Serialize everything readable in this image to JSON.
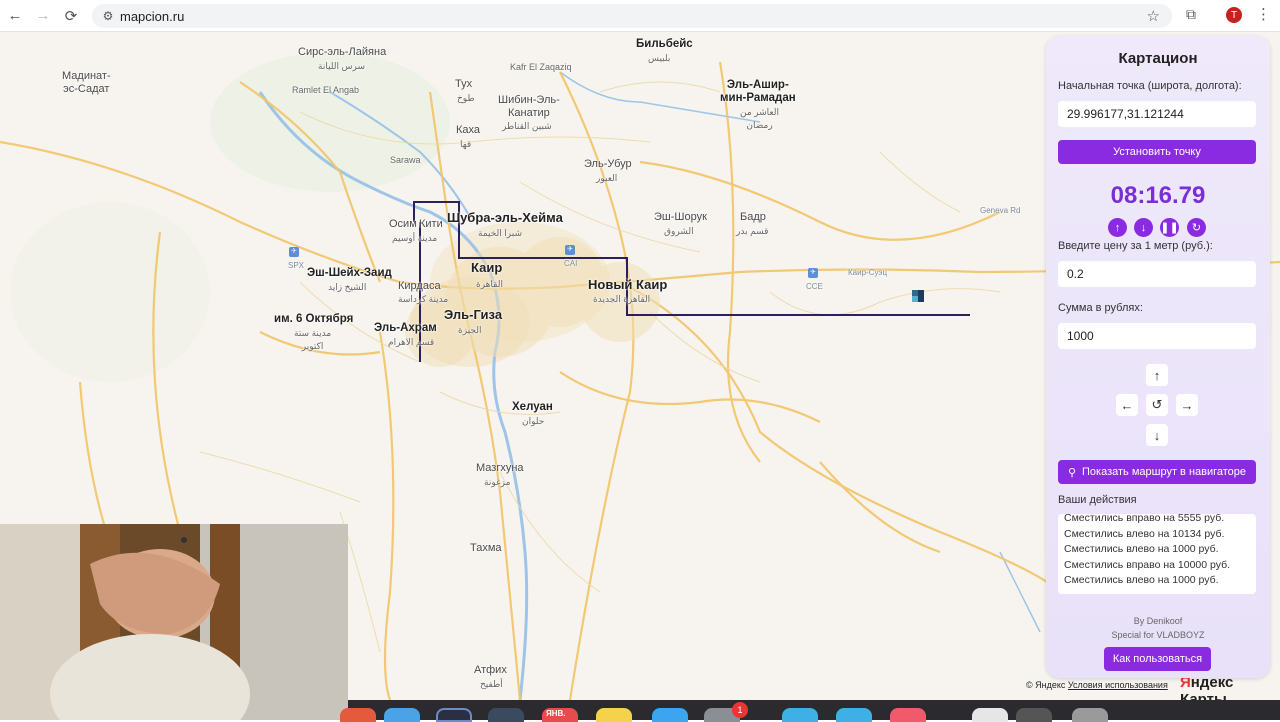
{
  "browser": {
    "url": "mapcion.ru",
    "avatar_letter": "T"
  },
  "map": {
    "labels": [
      {
        "id": "madinat",
        "text": "Мадинат-\nэс-Садат",
        "cls": ""
      },
      {
        "id": "sirs",
        "text": "Сирс-эль-Лайяна",
        "cls": ""
      },
      {
        "id": "sirs_ar",
        "text": "سرس الليانة",
        "cls": "s"
      },
      {
        "id": "ramlet",
        "text": "Ramlet El Angab",
        "cls": "s"
      },
      {
        "id": "bilbeis",
        "text": "Бильбейс",
        "cls": "b"
      },
      {
        "id": "bilbeis_ar",
        "text": "بلبيس",
        "cls": "s"
      },
      {
        "id": "kafr",
        "text": "Kafr El Zaqaziq",
        "cls": "s"
      },
      {
        "id": "tukh",
        "text": "Тух",
        "cls": ""
      },
      {
        "id": "tukh_ar",
        "text": "طوخ",
        "cls": "s"
      },
      {
        "id": "shibin",
        "text": "Шибин-Эль-\nКанатир",
        "cls": ""
      },
      {
        "id": "shibin_ar",
        "text": "شبين القناطر",
        "cls": "s"
      },
      {
        "id": "ashir",
        "text": "Эль-Ашир-\nмин-Рамадан",
        "cls": "b"
      },
      {
        "id": "ashir_ar",
        "text": "العاشر من\nرمضان",
        "cls": "s"
      },
      {
        "id": "kaha",
        "text": "Каха",
        "cls": ""
      },
      {
        "id": "kaha_ar",
        "text": "قها",
        "cls": "s"
      },
      {
        "id": "sarawa",
        "text": "Sarawa",
        "cls": "s"
      },
      {
        "id": "ubur",
        "text": "Эль-Убур",
        "cls": ""
      },
      {
        "id": "ubur_ar",
        "text": "العبور",
        "cls": "s"
      },
      {
        "id": "shubra",
        "text": "Шубра-эль-Хейма",
        "cls": "big"
      },
      {
        "id": "shubra_ar",
        "text": "شبرا الخيمة",
        "cls": "s"
      },
      {
        "id": "osim",
        "text": "Осим",
        "cls": ""
      },
      {
        "id": "osim_ar",
        "text": "مدينة أوسيم",
        "cls": "s"
      },
      {
        "id": "kiti",
        "text": "Кити",
        "cls": ""
      },
      {
        "id": "shoruk",
        "text": "Эш-Шорук",
        "cls": ""
      },
      {
        "id": "shoruk_ar",
        "text": "الشروق",
        "cls": "s"
      },
      {
        "id": "badr",
        "text": "Бадр",
        "cls": ""
      },
      {
        "id": "badr_ar",
        "text": "قسم بدر",
        "cls": "s"
      },
      {
        "id": "geneva",
        "text": "Geneva Rd",
        "cls": "xs"
      },
      {
        "id": "cai",
        "text": "CAI",
        "cls": "xs"
      },
      {
        "id": "spx",
        "text": "SPX",
        "cls": "xs"
      },
      {
        "id": "cairo",
        "text": "Каир",
        "cls": "big"
      },
      {
        "id": "cairo_ar",
        "text": "القاهرة",
        "cls": "s"
      },
      {
        "id": "newcairo",
        "text": "Новый Каир",
        "cls": "big"
      },
      {
        "id": "newcairo_ar",
        "text": "القاهرة الجديدة",
        "cls": "s"
      },
      {
        "id": "sheikh",
        "text": "Эш-Шейх-Заид",
        "cls": "b"
      },
      {
        "id": "sheikh_ar",
        "text": "الشيخ زايد",
        "cls": "s"
      },
      {
        "id": "kirdasa",
        "text": "Кирдаса",
        "cls": ""
      },
      {
        "id": "kirdasa_ar",
        "text": "مدينة كرداسة",
        "cls": "s"
      },
      {
        "id": "giza",
        "text": "Эль-Гиза",
        "cls": "big"
      },
      {
        "id": "giza_ar",
        "text": "الجيزة",
        "cls": "s"
      },
      {
        "id": "oct6",
        "text": "им. 6 Октября",
        "cls": "b"
      },
      {
        "id": "oct6_ar",
        "text": "مدينة ستة\nاكتوبر",
        "cls": "s"
      },
      {
        "id": "ahram",
        "text": "Эль-Ахрам",
        "cls": "b"
      },
      {
        "id": "ahram_ar",
        "text": "قسم الاهرام",
        "cls": "s"
      },
      {
        "id": "helwan",
        "text": "Хелуан",
        "cls": "b"
      },
      {
        "id": "helwan_ar",
        "text": "حلوان",
        "cls": "s"
      },
      {
        "id": "cce",
        "text": "CCE",
        "cls": "xs"
      },
      {
        "id": "karsuez",
        "text": "Каир-Суэц",
        "cls": "xs"
      },
      {
        "id": "mazg",
        "text": "Мазгхуна",
        "cls": ""
      },
      {
        "id": "mazg_ar",
        "text": "مزغونة",
        "cls": "s"
      },
      {
        "id": "tahma",
        "text": "Тахма",
        "cls": ""
      },
      {
        "id": "atfih",
        "text": "Атфих",
        "cls": ""
      },
      {
        "id": "atfih_ar",
        "text": "أطفيح",
        "cls": "s"
      }
    ],
    "copyright": "© Яндекс",
    "terms_link": "Условия использования",
    "brand": "Яндекс Карты"
  },
  "panel": {
    "title": "Картацион",
    "start_label": "Начальная точка (широта, долгота):",
    "start_value": "29.996177,31.121244",
    "set_point_button": "Установить точку",
    "timer": "08:16.79",
    "price_label": "Введите цену за 1 метр (руб.):",
    "price_value": "0.2",
    "sum_label": "Сумма в рублях:",
    "sum_value": "1000",
    "navigator_button": "Показать маршрут в навигаторе",
    "actions_label": "Ваши действия",
    "actions": [
      "Сместились вправо на 5555 руб.",
      "Сместились влево на 10134 руб.",
      "Сместились влево на 1000 руб.",
      "Сместились вправо на 10000 руб.",
      "Сместились влево на 1000 руб."
    ],
    "credit_by": "By Denikoof",
    "credit_special": "Special for VLADBOYZ",
    "howto_button": "Как пользоваться"
  },
  "dock": {
    "calendar_month": "ЯНВ.",
    "badge_count": "1"
  },
  "colors": {
    "accent": "#8a2be2",
    "route": "#2b1f5c",
    "timer": "#7a2ed6",
    "road_major": "#f2c66d"
  }
}
